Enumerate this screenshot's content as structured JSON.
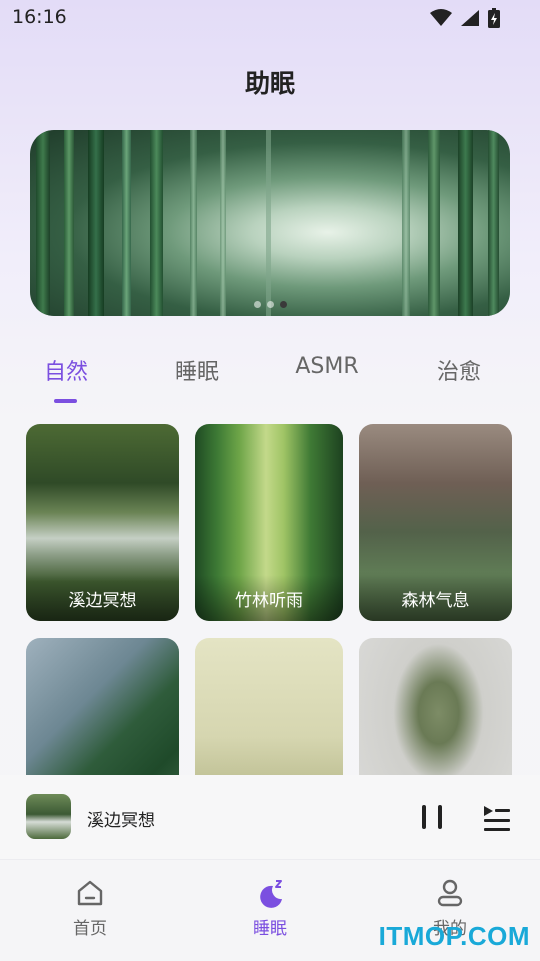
{
  "status_bar": {
    "time": "16:16",
    "icons": [
      "wifi-icon",
      "signal-icon",
      "battery-charging-icon"
    ]
  },
  "page_title": "助眠",
  "banner": {
    "dots": 3,
    "active_dot": 2
  },
  "tabs": [
    {
      "label": "自然",
      "active": true
    },
    {
      "label": "睡眠",
      "active": false
    },
    {
      "label": "ASMR",
      "active": false
    },
    {
      "label": "治愈",
      "active": false
    }
  ],
  "cards": [
    {
      "label": "溪边冥想",
      "image": "forest-stream"
    },
    {
      "label": "竹林听雨",
      "image": "bamboo-path"
    },
    {
      "label": "森林气息",
      "image": "pine-forest"
    },
    {
      "label": "",
      "image": "green-leaf"
    },
    {
      "label": "",
      "image": "dragonfly-grass-sketch"
    },
    {
      "label": "",
      "image": "tree-with-deer"
    }
  ],
  "mini_player": {
    "title": "溪边冥想",
    "state_icon": "pause-icon",
    "playlist_icon": "playlist-icon"
  },
  "bottom_nav": [
    {
      "label": "首页",
      "icon": "home-icon",
      "active": false
    },
    {
      "label": "睡眠",
      "icon": "moon-zzz-icon",
      "active": true
    },
    {
      "label": "我的",
      "icon": "user-icon",
      "active": false
    }
  ],
  "watermark": "ITMOP.COM",
  "colors": {
    "accent": "#7b4fe0",
    "watermark": "#19a9d8"
  }
}
